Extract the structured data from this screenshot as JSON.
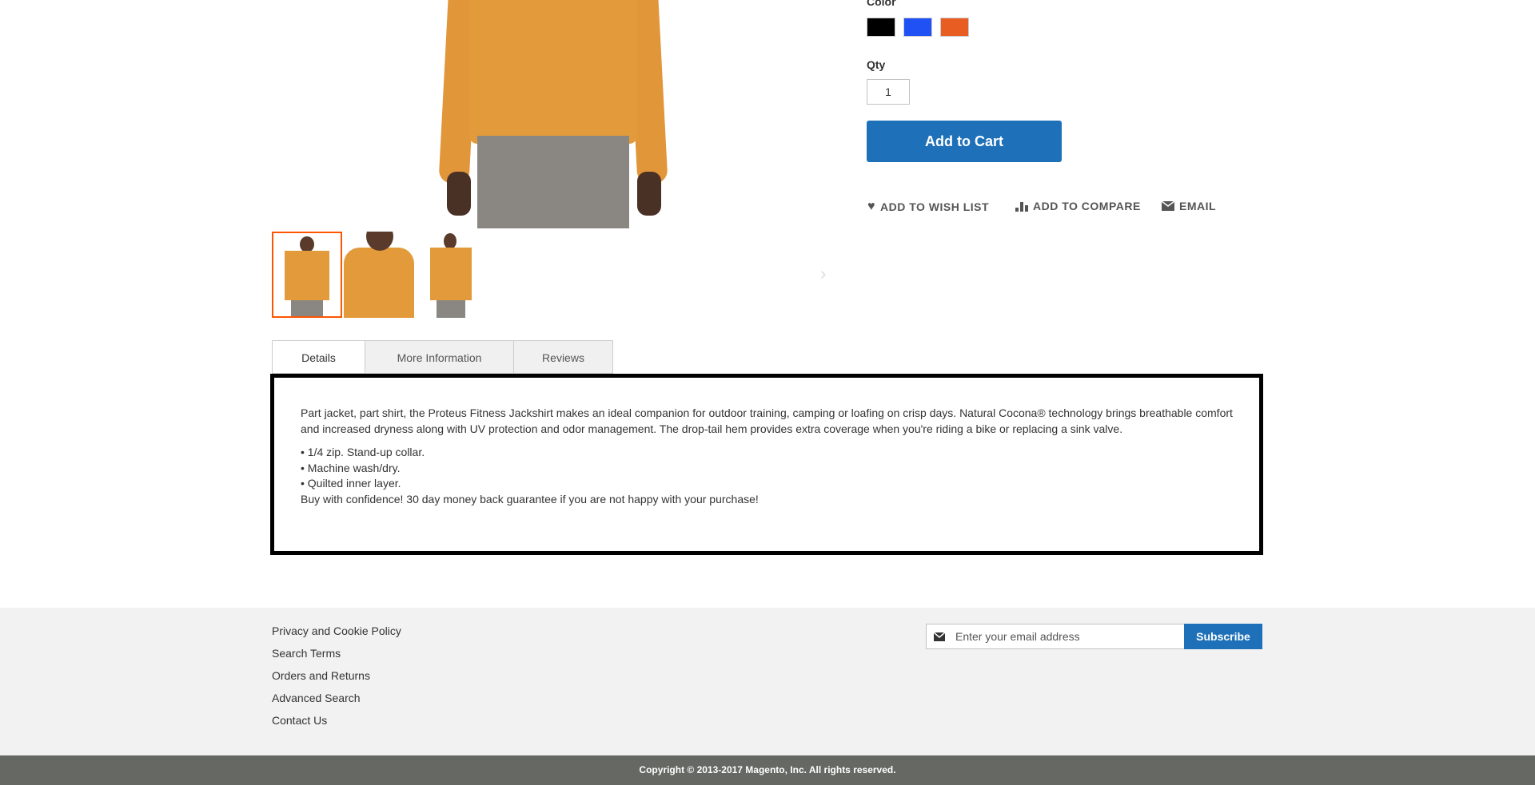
{
  "product": {
    "color_label": "Color",
    "swatches": [
      {
        "name": "Black",
        "color": "#000000"
      },
      {
        "name": "Blue",
        "color": "#1f51f5"
      },
      {
        "name": "Orange",
        "color": "#e85d22"
      }
    ],
    "qty_label": "Qty",
    "qty_value": "1",
    "add_to_cart": "Add to Cart",
    "actions": {
      "wishlist": "ADD TO WISH LIST",
      "compare": "ADD TO COMPARE",
      "email": "EMAIL"
    }
  },
  "gallery": {
    "next_arrow": "›"
  },
  "tabs": [
    {
      "label": "Details"
    },
    {
      "label": "More Information"
    },
    {
      "label": "Reviews"
    }
  ],
  "details": {
    "paragraph": "Part jacket, part shirt, the Proteus Fitness Jackshirt makes an ideal companion for outdoor training, camping or loafing on crisp days. Natural Cocona® technology brings breathable comfort and increased dryness along with UV protection and odor management. The drop-tail hem provides extra coverage when you're riding a bike or replacing a sink valve.",
    "bullets": [
      "• 1/4 zip. Stand-up collar.",
      "• Machine wash/dry.",
      "• Quilted inner layer."
    ],
    "guarantee": "Buy with confidence! 30 day money back guarantee if you are not happy with your purchase!"
  },
  "footer": {
    "links": [
      "Privacy and Cookie Policy",
      "Search Terms",
      "Orders and Returns",
      "Advanced Search",
      "Contact Us"
    ],
    "newsletter_placeholder": "Enter your email address",
    "subscribe": "Subscribe",
    "copyright": "Copyright © 2013-2017 Magento, Inc. All rights reserved."
  },
  "colors": {
    "accent": "#1e70b9",
    "selected_thumb": "#ff5501"
  }
}
